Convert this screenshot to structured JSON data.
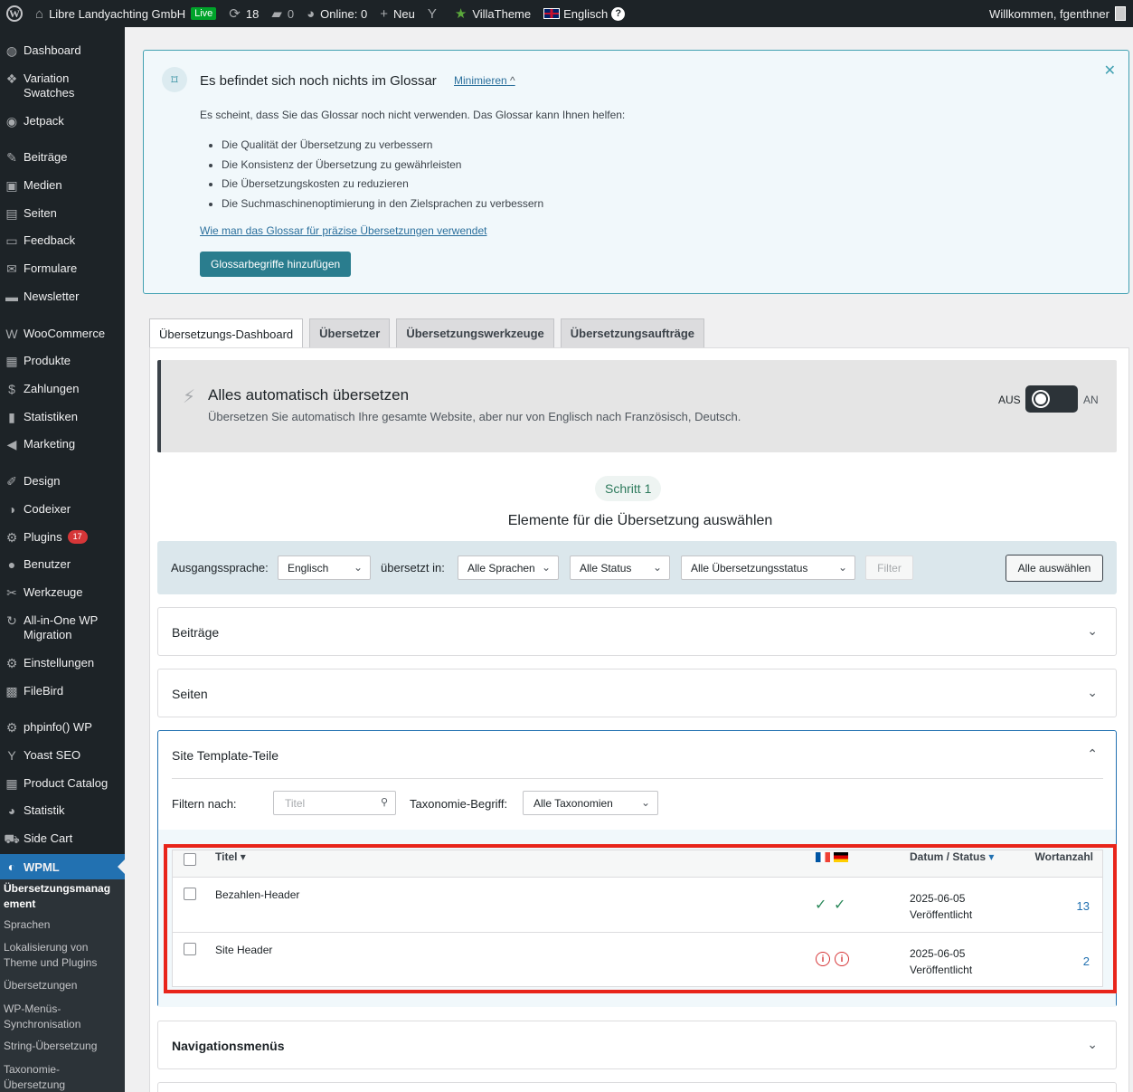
{
  "adminbar": {
    "site_name": "Libre Landyachting GmbH",
    "live_badge": "Live",
    "updates_count": "18",
    "comments_count": "0",
    "online": "Online: 0",
    "new_label": "Neu",
    "villatheme": "VillaTheme",
    "language": "Englisch",
    "welcome": "Willkommen, fgenthner"
  },
  "sidebar": {
    "items": [
      {
        "label": "Dashboard",
        "icon": "dashboard-icon"
      },
      {
        "label": "Variation Swatches",
        "icon": "swatches-icon"
      },
      {
        "label": "Jetpack",
        "icon": "jetpack-icon"
      },
      {
        "label": "Beiträge",
        "icon": "pin-icon"
      },
      {
        "label": "Medien",
        "icon": "media-icon"
      },
      {
        "label": "Seiten",
        "icon": "pages-icon"
      },
      {
        "label": "Feedback",
        "icon": "feedback-icon"
      },
      {
        "label": "Formulare",
        "icon": "mail-icon"
      },
      {
        "label": "Newsletter",
        "icon": "newsletter-icon"
      },
      {
        "label": "WooCommerce",
        "icon": "woo-icon"
      },
      {
        "label": "Produkte",
        "icon": "archive-icon"
      },
      {
        "label": "Zahlungen",
        "icon": "payments-icon"
      },
      {
        "label": "Statistiken",
        "icon": "bar-chart-icon"
      },
      {
        "label": "Marketing",
        "icon": "megaphone-icon"
      },
      {
        "label": "Design",
        "icon": "brush-icon"
      },
      {
        "label": "Codeixer",
        "icon": "codeixer-icon"
      },
      {
        "label": "Plugins",
        "icon": "plugin-icon",
        "badge": "17"
      },
      {
        "label": "Benutzer",
        "icon": "user-icon"
      },
      {
        "label": "Werkzeuge",
        "icon": "wrench-icon"
      },
      {
        "label": "All-in-One WP Migration",
        "icon": "migration-icon"
      },
      {
        "label": "Einstellungen",
        "icon": "settings-icon"
      },
      {
        "label": "FileBird",
        "icon": "filebird-icon"
      },
      {
        "label": "phpinfo() WP",
        "icon": "php-icon"
      },
      {
        "label": "Yoast SEO",
        "icon": "yoast-icon"
      },
      {
        "label": "Product Catalog",
        "icon": "catalog-icon"
      },
      {
        "label": "Statistik",
        "icon": "pie-icon"
      },
      {
        "label": "Side Cart",
        "icon": "cart-icon"
      }
    ],
    "wpml_label": "WPML",
    "submenu": [
      "Übersetzungsmanag ement",
      "Sprachen",
      "Lokalisierung von Theme und Plugins",
      "Übersetzungen",
      "WP-Menüs-Synchronisation",
      "String-Übersetzung",
      "Taxonomie-Übersetzung"
    ]
  },
  "glossary": {
    "title": "Es befindet sich noch nichts im Glossar",
    "minimize": "Minimieren",
    "intro": "Es scheint, dass Sie das Glossar noch nicht verwenden. Das Glossar kann Ihnen helfen:",
    "bullets": [
      "Die Qualität der Übersetzung zu verbessern",
      "Die Konsistenz der Übersetzung zu gewährleisten",
      "Die Übersetzungskosten zu reduzieren",
      "Die Suchmaschinenoptimierung in den Zielsprachen zu verbessern"
    ],
    "howto_link": "Wie man das Glossar für präzise Übersetzungen verwendet",
    "add_button": "Glossarbegriffe hinzufügen"
  },
  "tabs": [
    "Übersetzungs-Dashboard",
    "Übersetzer",
    "Übersetzungswerkzeuge",
    "Übersetzungsaufträge"
  ],
  "auto_translate": {
    "title": "Alles automatisch übersetzen",
    "description": "Übersetzen Sie automatisch Ihre gesamte Website, aber nur von Englisch nach Französisch, Deutsch.",
    "off_label": "AUS",
    "on_label": "AN",
    "enabled": false
  },
  "step": {
    "pill": "Schritt 1",
    "title": "Elemente für die Übersetzung auswählen"
  },
  "filters": {
    "source_label": "Ausgangssprache:",
    "source_value": "Englisch",
    "translated_label": "übersetzt in:",
    "languages_value": "Alle Sprachen",
    "status_value": "Alle Status",
    "translation_status_value": "Alle Übersetzungsstatus",
    "filter_button": "Filter",
    "select_all_button": "Alle auswählen"
  },
  "sections": {
    "beitraege": "Beiträge",
    "seiten": "Seiten",
    "site_template": "Site Template-Teile",
    "nav_menus": "Navigationsmenüs"
  },
  "site_template": {
    "filter_label": "Filtern nach:",
    "title_placeholder": "Titel",
    "taxonomy_label": "Taxonomie-Begriff:",
    "taxonomy_value": "Alle Taxonomien",
    "columns": {
      "title": "Titel",
      "date_status": "Datum / Status",
      "word_count": "Wortanzahl"
    },
    "rows": [
      {
        "title": "Bezahlen-Header",
        "status": "complete",
        "date": "2025-06-05",
        "state": "Veröffentlicht",
        "words": "13"
      },
      {
        "title": "Site Header",
        "status": "needs-update",
        "date": "2025-06-05",
        "state": "Veröffentlicht",
        "words": "2"
      }
    ]
  }
}
